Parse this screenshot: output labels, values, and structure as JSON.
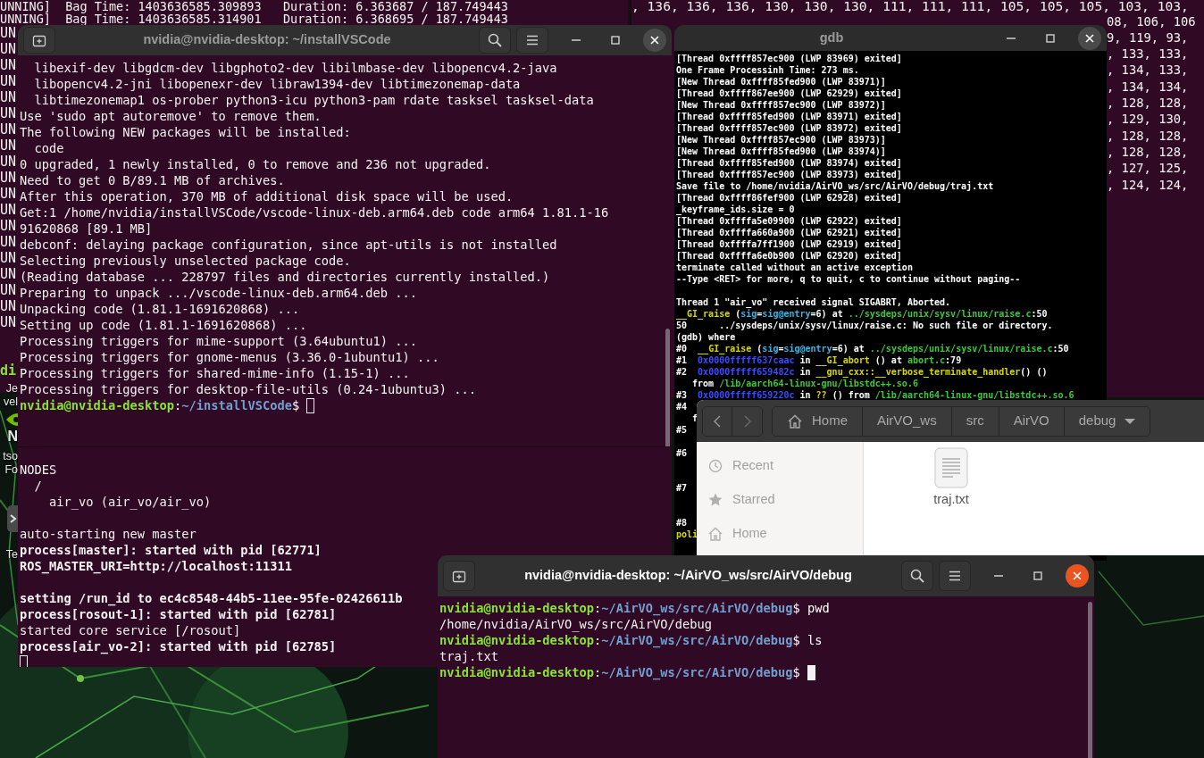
{
  "left_background_terminal": {
    "lines": [
      {
        "kind": "full",
        "text": "UNNING]  Bag Time: 1403636585.309893   Duration: 6.363687 / 187.749443"
      },
      {
        "kind": "full",
        "text": "UNNING]  Bag Time: 1403636585.314901   Duration: 6.368695 / 187.749443"
      },
      {
        "kind": "text",
        "text": "UN"
      },
      {
        "kind": "text",
        "text": "UN"
      },
      {
        "kind": "text",
        "text": "UN"
      },
      {
        "kind": "text",
        "text": "UN"
      },
      {
        "kind": "text",
        "text": "UN"
      },
      {
        "kind": "text",
        "text": "UN"
      },
      {
        "kind": "text",
        "text": "UN"
      },
      {
        "kind": "text",
        "text": "UN"
      },
      {
        "kind": "text",
        "text": "UN"
      },
      {
        "kind": "text",
        "text": "UN"
      },
      {
        "kind": "text",
        "text": "UN"
      },
      {
        "kind": "text",
        "text": "UN"
      },
      {
        "kind": "text",
        "text": "UN"
      },
      {
        "kind": "text",
        "text": "UN"
      },
      {
        "kind": "text",
        "text": "UN"
      },
      {
        "kind": "text",
        "text": "UN"
      },
      {
        "kind": "text",
        "text": "UN"
      },
      {
        "kind": "text",
        "text": "UN"
      },
      {
        "kind": "text",
        "text": "UN"
      },
      {
        "kind": "blank"
      },
      {
        "kind": "blank"
      },
      {
        "kind": "prompt",
        "text": "di"
      }
    ]
  },
  "right_background_terminal": {
    "lines": [
      {
        "kind": "full",
        "text": ", 136, 136, 136, 130, 130, 130, 111, 111, 111, 105, 105, 105, 103, 103,"
      },
      {
        "kind": "tail",
        "text": "08, 106, 106"
      },
      {
        "kind": "tail",
        "text": "9, 119, 93,"
      },
      {
        "kind": "tail",
        "text": ", 133, 133,"
      },
      {
        "kind": "tail",
        "text": ", 134, 133,"
      },
      {
        "kind": "tail",
        "text": ", 134, 134,"
      },
      {
        "kind": "tail",
        "text": ", 128, 128,"
      },
      {
        "kind": "tail",
        "text": ", 129, 130,"
      },
      {
        "kind": "tail",
        "text": ", 128, 128,"
      },
      {
        "kind": "tail",
        "text": ", 128, 128,"
      },
      {
        "kind": "tail",
        "text": ", 127, 125,"
      },
      {
        "kind": "tail",
        "text": ", 124, 124,"
      }
    ]
  },
  "desktop_labels": [
    "Je",
    "vel",
    "N",
    "tso",
    "Fo",
    "Te"
  ],
  "install_terminal": {
    "title": "nvidia@nvidia-desktop: ~/installVSCode",
    "focused": false,
    "cursor": {
      "kind": "outline"
    },
    "lines": [
      {
        "kind": "text",
        "text": "  libexif-dev libgdcm-dev libgphoto2-dev libilmbase-dev libopencv4.2-java"
      },
      {
        "kind": "text",
        "text": "  libopencv4.2-jni libopenexr-dev libraw1394-dev libtimezonemap-data"
      },
      {
        "kind": "text",
        "text": "  libtimezonemap1 os-prober python3-icu python3-pam rdate tasksel tasksel-data"
      },
      {
        "kind": "text",
        "text": "Use 'sudo apt autoremove' to remove them."
      },
      {
        "kind": "text",
        "text": "The following NEW packages will be installed:"
      },
      {
        "kind": "text",
        "text": "  code"
      },
      {
        "kind": "text",
        "text": "0 upgraded, 1 newly installed, 0 to remove and 236 not upgraded."
      },
      {
        "kind": "text",
        "text": "Need to get 0 B/89.1 MB of archives."
      },
      {
        "kind": "text",
        "text": "After this operation, 370 MB of additional disk space will be used."
      },
      {
        "kind": "text",
        "text": "Get:1 /home/nvidia/installVSCode/vscode-linux-deb.arm64.deb code arm64 1.81.1-16"
      },
      {
        "kind": "text",
        "text": "91620868 [89.1 MB]"
      },
      {
        "kind": "text",
        "text": "debconf: delaying package configuration, since apt-utils is not installed"
      },
      {
        "kind": "text",
        "text": "Selecting previously unselected package code."
      },
      {
        "kind": "text",
        "text": "(Reading database ... 228797 files and directories currently installed.)"
      },
      {
        "kind": "text",
        "text": "Preparing to unpack .../vscode-linux-deb.arm64.deb ..."
      },
      {
        "kind": "text",
        "text": "Unpacking code (1.81.1-1691620868) ..."
      },
      {
        "kind": "text",
        "text": "Setting up code (1.81.1-1691620868) ..."
      },
      {
        "kind": "text",
        "text": "Processing triggers for mime-support (3.64ubuntu1) ..."
      },
      {
        "kind": "text",
        "text": "Processing triggers for gnome-menus (3.36.0-1ubuntu1) ..."
      },
      {
        "kind": "text",
        "text": "Processing triggers for shared-mime-info (1.15-1) ..."
      },
      {
        "kind": "text",
        "text": "Processing triggers for desktop-file-utils (0.24-1ubuntu3) ..."
      },
      {
        "kind": "rich",
        "segments": [
          {
            "text": "nvidia@nvidia-desktop",
            "color": "#8ae234",
            "bold": true
          },
          {
            "text": ":",
            "color": "#ffffff",
            "bold": false
          },
          {
            "text": "~/installVSCode",
            "color": "#729fcf",
            "bold": true
          },
          {
            "text": "$ ",
            "color": "#ffffff",
            "bold": false
          }
        ]
      }
    ]
  },
  "ros_terminal": {
    "cursor": {
      "kind": "outline"
    },
    "lines": [
      {
        "kind": "text",
        "text": "NODES"
      },
      {
        "kind": "text",
        "text": "  /"
      },
      {
        "kind": "text",
        "text": "    air_vo (air_vo/air_vo)"
      },
      {
        "kind": "blank"
      },
      {
        "kind": "text",
        "text": "auto-starting new master"
      },
      {
        "kind": "bold",
        "text": "process[master]: started with pid [62771]"
      },
      {
        "kind": "bold",
        "text": "ROS_MASTER_URI=http://localhost:11311"
      },
      {
        "kind": "blank"
      },
      {
        "kind": "bold",
        "text": "setting /run_id to ec4c8548-44b5-11ee-95fe-02426611b"
      },
      {
        "kind": "bold",
        "text": "process[rosout-1]: started with pid [62781]"
      },
      {
        "kind": "text",
        "text": "started core service [/rosout]"
      },
      {
        "kind": "bold",
        "text": "process[air_vo-2]: started with pid [62785]"
      },
      {
        "kind": "blank"
      }
    ]
  },
  "gdb_window": {
    "title": "gdb",
    "focused": false,
    "lines": [
      {
        "kind": "text",
        "text": "[Thread 0xffff857ec900 (LWP 83969) exited]"
      },
      {
        "kind": "text",
        "text": "One Frame Processinh Time: 273 ms."
      },
      {
        "kind": "text",
        "text": "[New Thread 0xffff85fed900 (LWP 83971)]"
      },
      {
        "kind": "text",
        "text": "[Thread 0xffff867ee900 (LWP 62929) exited]"
      },
      {
        "kind": "text",
        "text": "[New Thread 0xffff857ec900 (LWP 83972)]"
      },
      {
        "kind": "text",
        "text": "[Thread 0xffff85fed900 (LWP 83971) exited]"
      },
      {
        "kind": "text",
        "text": "[Thread 0xffff857ec900 (LWP 83972) exited]"
      },
      {
        "kind": "text",
        "text": "[New Thread 0xffff857ec900 (LWP 83973)]"
      },
      {
        "kind": "text",
        "text": "[New Thread 0xffff85fed900 (LWP 83974)]"
      },
      {
        "kind": "text",
        "text": "[Thread 0xffff85fed900 (LWP 83974) exited]"
      },
      {
        "kind": "text",
        "text": "[Thread 0xffff857ec900 (LWP 83973) exited]"
      },
      {
        "kind": "text",
        "text": "Save file to /home/nvidia/AirVO_ws/src/AirVO/debug/traj.txt"
      },
      {
        "kind": "text",
        "text": "[Thread 0xffff86fef900 (LWP 62928) exited]"
      },
      {
        "kind": "text",
        "text": "_keyframe_ids.size = 0"
      },
      {
        "kind": "text",
        "text": "[Thread 0xffffa5e09900 (LWP 62922) exited]"
      },
      {
        "kind": "text",
        "text": "[Thread 0xffffa660a900 (LWP 62921) exited]"
      },
      {
        "kind": "text",
        "text": "[Thread 0xffffa7ff1900 (LWP 62919) exited]"
      },
      {
        "kind": "text",
        "text": "[Thread 0xffffa6e0b900 (LWP 62920) exited]"
      },
      {
        "kind": "text",
        "text": "terminate called without an active exception"
      },
      {
        "kind": "text",
        "text": "--Type <RET> for more, q to quit, c to continue without paging--"
      },
      {
        "kind": "blank"
      },
      {
        "kind": "text",
        "text": "Thread 1 \"air_vo\" received signal SIGABRT, Aborted."
      },
      {
        "kind": "rich",
        "segments": [
          {
            "text": "__GI_raise",
            "color": "#d7d700"
          },
          {
            "text": " ("
          },
          {
            "text": "sig",
            "color": "#3cb4e0"
          },
          {
            "text": "=",
            "color": "#ffffff"
          },
          {
            "text": "sig@entry",
            "color": "#3cb4e0"
          },
          {
            "text": "=6) at ",
            "color": "#ffffff"
          },
          {
            "text": "../sysdeps/unix/sysv/linux/raise.c",
            "color": "#3cc83c"
          },
          {
            "text": ":50",
            "color": "#ffffff"
          }
        ]
      },
      {
        "kind": "text",
        "text": "50      ../sysdeps/unix/sysv/linux/raise.c: No such file or directory."
      },
      {
        "kind": "text",
        "text": "(gdb) where"
      },
      {
        "kind": "rich",
        "segments": [
          {
            "text": "#0  ",
            "color": "#ffffff"
          },
          {
            "text": "__GI_raise",
            "color": "#d7d700"
          },
          {
            "text": " ("
          },
          {
            "text": "sig",
            "color": "#3cb4e0"
          },
          {
            "text": "=",
            "color": "#ffffff"
          },
          {
            "text": "sig@entry",
            "color": "#3cb4e0"
          },
          {
            "text": "=6) at ",
            "color": "#ffffff"
          },
          {
            "text": "../sysdeps/unix/sysv/linux/raise.c",
            "color": "#3cc83c"
          },
          {
            "text": ":50",
            "color": "#ffffff"
          }
        ]
      },
      {
        "kind": "rich",
        "segments": [
          {
            "text": "#1  ",
            "color": "#ffffff"
          },
          {
            "text": "0x0000fffff637caac",
            "color": "#3b4bff"
          },
          {
            "text": " in ",
            "color": "#ffffff"
          },
          {
            "text": "__GI_abort",
            "color": "#d7d700"
          },
          {
            "text": " () at ",
            "color": "#ffffff"
          },
          {
            "text": "abort.c",
            "color": "#3cc83c"
          },
          {
            "text": ":79",
            "color": "#ffffff"
          }
        ]
      },
      {
        "kind": "rich",
        "segments": [
          {
            "text": "#2  ",
            "color": "#ffffff"
          },
          {
            "text": "0x0000fffff659482c",
            "color": "#3b4bff"
          },
          {
            "text": " in ",
            "color": "#ffffff"
          },
          {
            "text": "__gnu_cxx::__verbose_terminate_handler",
            "color": "#d7d700"
          },
          {
            "text": "() ()",
            "color": "#ffffff"
          }
        ]
      },
      {
        "kind": "rich",
        "segments": [
          {
            "text": "   from ",
            "color": "#ffffff"
          },
          {
            "text": "/lib/aarch64-linux-gnu/libstdc++.so.6",
            "color": "#3cc83c"
          }
        ]
      },
      {
        "kind": "rich",
        "segments": [
          {
            "text": "#3  ",
            "color": "#ffffff"
          },
          {
            "text": "0x0000fffff659220c",
            "color": "#3b4bff"
          },
          {
            "text": " in ",
            "color": "#ffffff"
          },
          {
            "text": "??",
            "color": "#d7d700"
          },
          {
            "text": " () from ",
            "color": "#ffffff"
          },
          {
            "text": "/lib/aarch64-linux-gnu/libstdc++.so.6",
            "color": "#3cc83c"
          }
        ]
      },
      {
        "kind": "text",
        "text": "#4"
      },
      {
        "kind": "text",
        "text": "   f"
      },
      {
        "kind": "text",
        "text": "#5"
      },
      {
        "kind": "blank"
      },
      {
        "kind": "text",
        "text": "#6"
      },
      {
        "kind": "blank"
      },
      {
        "kind": "blank"
      },
      {
        "kind": "text",
        "text": "#7"
      },
      {
        "kind": "blank"
      },
      {
        "kind": "blank"
      },
      {
        "kind": "text",
        "text": "#8"
      },
      {
        "kind": "rich",
        "segments": [
          {
            "text": "poli",
            "color": "#d7d700"
          }
        ]
      }
    ]
  },
  "file_manager": {
    "path": [
      "Home",
      "AirVO_ws",
      "src",
      "AirVO",
      "debug"
    ],
    "sidebar": [
      {
        "label": "Recent"
      },
      {
        "label": "Starred"
      },
      {
        "label": "Home"
      }
    ],
    "files": [
      {
        "name": "traj.txt"
      }
    ]
  },
  "debug_terminal": {
    "title": "nvidia@nvidia-desktop: ~/AirVO_ws/src/AirVO/debug",
    "focused": true,
    "cursor": {
      "kind": "block"
    },
    "lines": [
      {
        "kind": "rich",
        "segments": [
          {
            "text": "nvidia@nvidia-desktop",
            "color": "#8ae234",
            "bold": true
          },
          {
            "text": ":",
            "color": "#ffffff",
            "bold": false
          },
          {
            "text": "~/AirVO_ws/src/AirVO/debug",
            "color": "#729fcf",
            "bold": true
          },
          {
            "text": "$ pwd",
            "color": "#ffffff",
            "bold": false
          }
        ]
      },
      {
        "kind": "text",
        "text": "/home/nvidia/AirVO_ws/src/AirVO/debug"
      },
      {
        "kind": "rich",
        "segments": [
          {
            "text": "nvidia@nvidia-desktop",
            "color": "#8ae234",
            "bold": true
          },
          {
            "text": ":",
            "color": "#ffffff",
            "bold": false
          },
          {
            "text": "~/AirVO_ws/src/AirVO/debug",
            "color": "#729fcf",
            "bold": true
          },
          {
            "text": "$ ls",
            "color": "#ffffff",
            "bold": false
          }
        ]
      },
      {
        "kind": "text",
        "text": "traj.txt"
      },
      {
        "kind": "rich",
        "segments": [
          {
            "text": "nvidia@nvidia-desktop",
            "color": "#8ae234",
            "bold": true
          },
          {
            "text": ":",
            "color": "#ffffff",
            "bold": false
          },
          {
            "text": "~/AirVO_ws/src/AirVO/debug",
            "color": "#729fcf",
            "bold": true
          },
          {
            "text": "$ ",
            "color": "#ffffff",
            "bold": false
          }
        ]
      }
    ]
  }
}
